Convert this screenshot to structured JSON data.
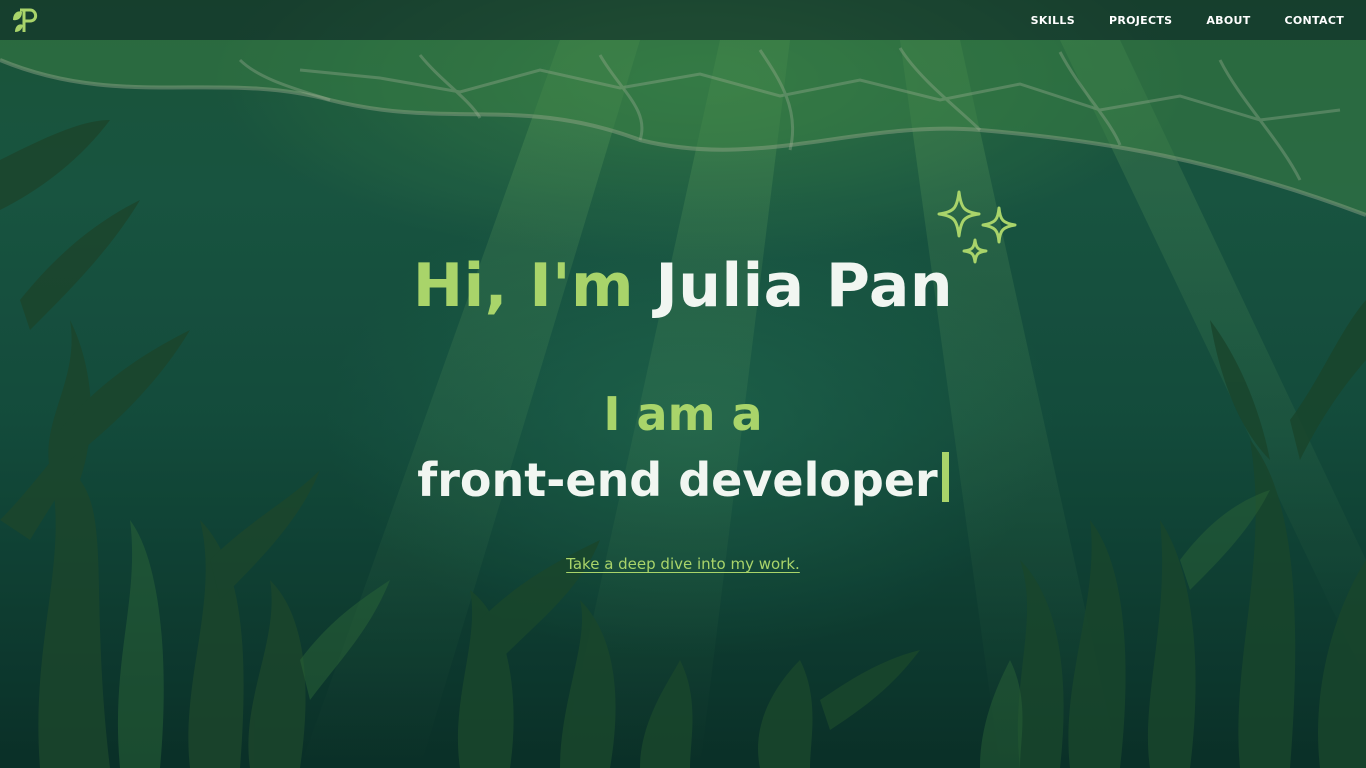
{
  "header": {
    "logo_icon": "leaf-p-monogram-icon",
    "nav": [
      {
        "label": "SKILLS"
      },
      {
        "label": "PROJECTS"
      },
      {
        "label": "ABOUT"
      },
      {
        "label": "CONTACT"
      }
    ]
  },
  "hero": {
    "greeting": "Hi, I'm",
    "name": "Julia Pan",
    "sparkle_icon": "sparkles-icon",
    "intro": "I am a",
    "role": "front-end developer",
    "cta_label": "Take a deep dive into my work."
  },
  "colors": {
    "accent": "#a9d46a",
    "text": "#f1f6f1",
    "background": "#15503f"
  }
}
